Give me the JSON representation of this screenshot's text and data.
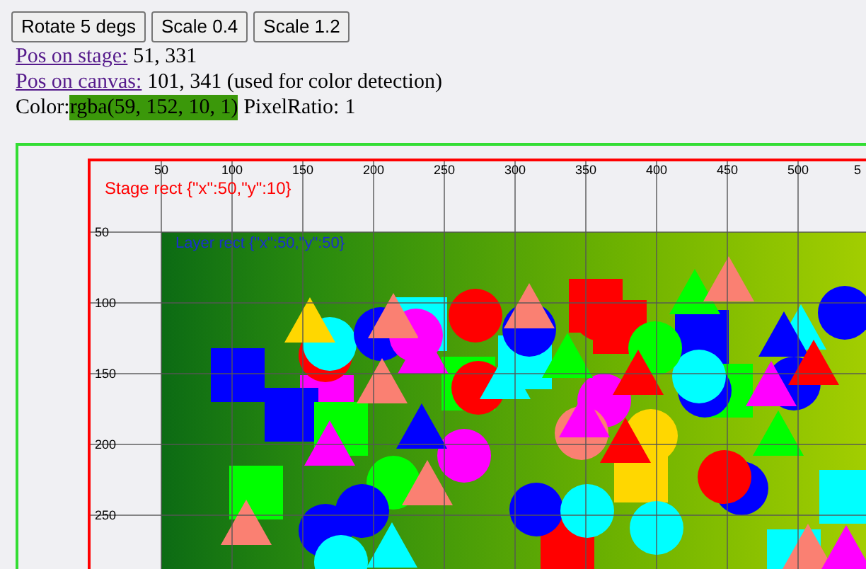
{
  "buttons": [
    {
      "label": "Rotate 5 degs"
    },
    {
      "label": "Scale 0.4"
    },
    {
      "label": "Scale 1.2"
    }
  ],
  "pos_on_stage": {
    "label": "Pos on stage:",
    "value": "51, 331"
  },
  "pos_on_canvas": {
    "label": "Pos on canvas:",
    "value": "101, 341 (used for color detection)"
  },
  "color": {
    "label": "Color:",
    "value": "rgba(59, 152, 10, 1)",
    "pixel_ratio_label": "PixelRatio:",
    "pixel_ratio": "1"
  },
  "canvas": {
    "stage_label": "Stage rect {\"x\":50,\"y\":10}",
    "layer_label": "Layer rect {\"x\":50,\"y\":50}",
    "x_ticks": [
      "50",
      "100",
      "150",
      "200",
      "250",
      "300",
      "350",
      "400",
      "450",
      "500",
      "5"
    ],
    "y_ticks": [
      "50",
      "100",
      "150",
      "200",
      "250"
    ]
  }
}
